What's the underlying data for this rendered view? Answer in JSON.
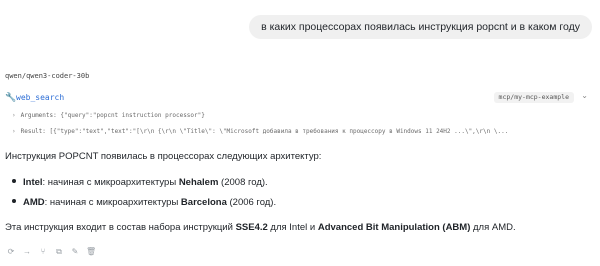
{
  "user_message": "в каких процессорах появилась инструкция popcnt и в каком году",
  "model_name": "qwen/qwen3-coder-30b",
  "tool_call": {
    "name": "web_search",
    "server": "mcp/my-mcp-example",
    "arguments_label": "Arguments:",
    "arguments_value": "{\"query\":\"popcnt instruction processor\"}",
    "result_label": "Result:",
    "result_value": "[{\"type\":\"text\",\"text\":\"[\\r\\n {\\r\\n \\\"Title\\\": \\\"Microsoft добавила в требования к процессору в Windows 11 24H2 ...\\\",\\r\\n \\..."
  },
  "answer": {
    "intro": "Инструкция POPCNT появилась в процессорах следующих архитектур:",
    "items": [
      {
        "vendor": "Intel",
        "text_a": ": начиная с микроархитектуры ",
        "arch": "Nehalem",
        "text_b": " (2008 год)."
      },
      {
        "vendor": "AMD",
        "text_a": ": начиная с микроархитектуры ",
        "arch": "Barcelona",
        "text_b": " (2006 год)."
      }
    ],
    "outro": {
      "a": "Эта инструкция входит в состав набора инструкций ",
      "sse": "SSE4.2",
      "b": " для Intel и ",
      "abm": "Advanced Bit Manipulation (ABM)",
      "c": " для AMD."
    }
  },
  "icons": [
    "regenerate-icon",
    "next-icon",
    "branch-icon",
    "copy-icon",
    "edit-icon",
    "delete-icon"
  ]
}
